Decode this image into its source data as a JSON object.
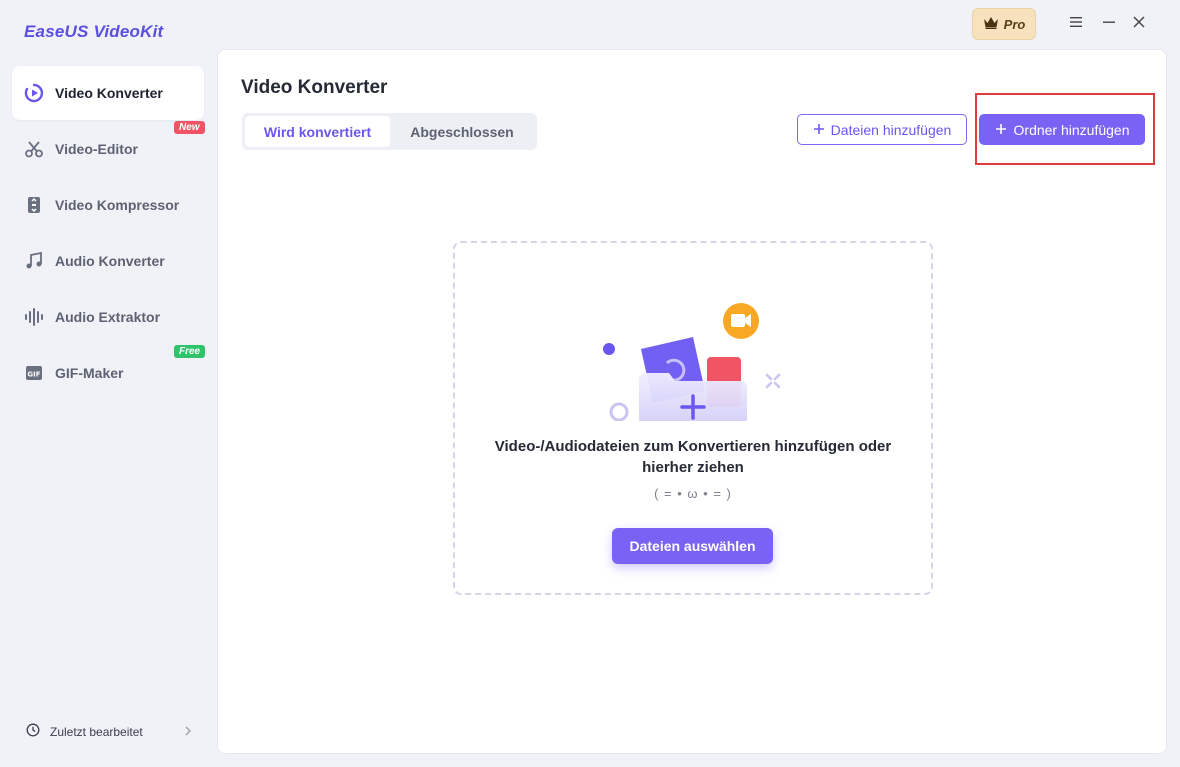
{
  "app": {
    "title": "EaseUS VideoKit",
    "pro_label": "Pro"
  },
  "sidebar": {
    "items": [
      {
        "label": "Video Konverter",
        "icon": "play-circle-icon",
        "active": true
      },
      {
        "label": "Video-Editor",
        "icon": "scissors-icon",
        "badge": "New"
      },
      {
        "label": "Video Kompressor",
        "icon": "compress-icon"
      },
      {
        "label": "Audio Konverter",
        "icon": "music-note-icon"
      },
      {
        "label": "Audio Extraktor",
        "icon": "waveform-icon"
      },
      {
        "label": "GIF-Maker",
        "icon": "gif-icon",
        "badge": "Free"
      }
    ],
    "recent_label": "Zuletzt bearbeitet"
  },
  "main": {
    "title": "Video Konverter",
    "tabs": [
      {
        "label": "Wird konvertiert",
        "active": true
      },
      {
        "label": "Abgeschlossen",
        "active": false
      }
    ],
    "add_files_label": "Dateien hinzufügen",
    "add_folder_label": "Ordner hinzufügen",
    "dropzone": {
      "text": "Video-/Audiodateien zum Konvertieren hinzufügen oder hierher ziehen",
      "kaomoji": "( = • ω • = )",
      "select_label": "Dateien auswählen"
    }
  },
  "colors": {
    "accent": "#7a62f5",
    "brand_title": "#5b4fe0",
    "highlight": "#e33b3b",
    "badge_new": "#f25466",
    "badge_free": "#2fc46b"
  }
}
